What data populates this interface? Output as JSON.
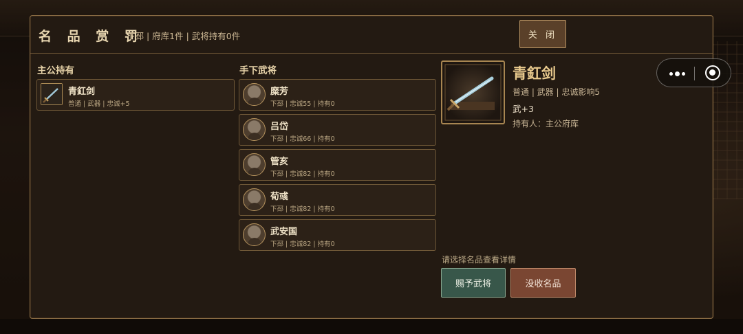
{
  "modal": {
    "title": "名 品 赏 罚",
    "subtitle": "下邳 | 府库1件 | 武将持有0件",
    "close_label": "关 闭"
  },
  "lord_section": {
    "title": "主公持有",
    "items": [
      {
        "name": "青釭剑",
        "meta": "普通 | 武器 | 忠诚+5",
        "icon": "sword-icon"
      }
    ]
  },
  "generals_section": {
    "title": "手下武将",
    "generals": [
      {
        "name": "糜芳",
        "meta": "下邳 | 忠诚55 | 持有0"
      },
      {
        "name": "吕岱",
        "meta": "下邳 | 忠诚66 | 持有0"
      },
      {
        "name": "管亥",
        "meta": "下邳 | 忠诚82 | 持有0"
      },
      {
        "name": "荀彧",
        "meta": "下邳 | 忠诚82 | 持有0"
      },
      {
        "name": "武安国",
        "meta": "下邳 | 忠诚82 | 持有0"
      }
    ]
  },
  "detail": {
    "name": "青釭剑",
    "meta": "普通 | 武器 | 忠诚影响5",
    "bonus": "武+3",
    "holder": "持有人：主公府库",
    "icon": "sword-icon"
  },
  "actions": {
    "hint": "请选择名品查看详情",
    "grant_label": "赐予武将",
    "confiscate_label": "没收名品"
  },
  "colors": {
    "accent_gold": "#e8c98d",
    "grant_green": "#38574a",
    "confiscate_red": "#7a4632"
  }
}
